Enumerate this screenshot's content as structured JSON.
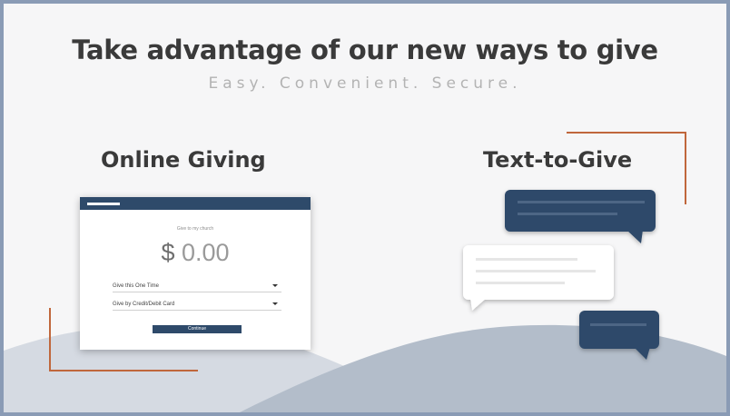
{
  "headline": "Take advantage of our new ways to give",
  "subline": "Easy. Convenient. Secure.",
  "online_giving": {
    "title": "Online Giving",
    "form": {
      "caption": "Give to my church",
      "currency": "$",
      "amount": "0.00",
      "frequency": "Give this One Time",
      "payment": "Give by Credit/Debit Card",
      "continue_label": "Continue"
    }
  },
  "text_to_give": {
    "title": "Text-to-Give"
  },
  "colors": {
    "navy": "#2e4a6a",
    "accent": "#c0673c",
    "frame": "#8a9bb5"
  }
}
